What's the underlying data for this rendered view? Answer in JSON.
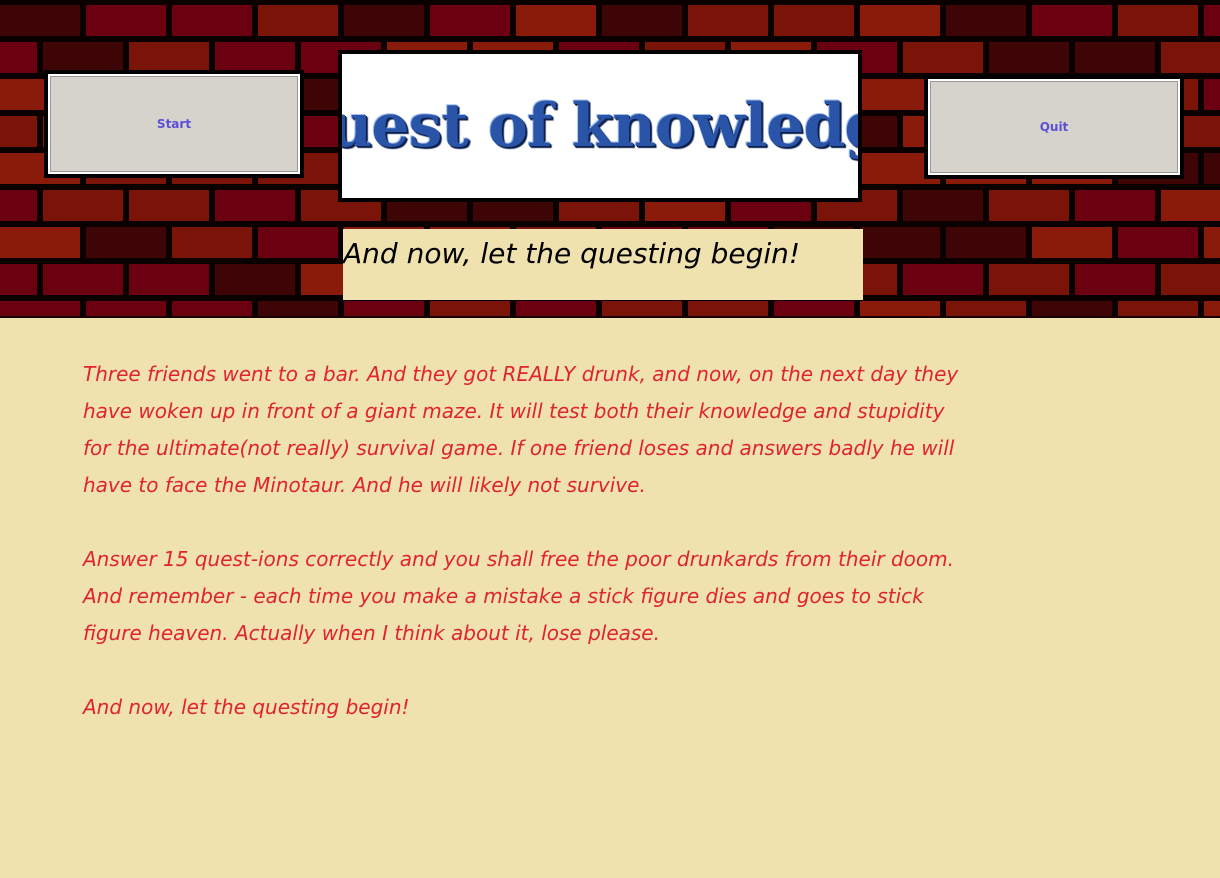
{
  "header": {
    "start_label": "Start",
    "quit_label": "Quit",
    "title": "Quest of knowledge",
    "subtitle": "And now, let the questing begin!"
  },
  "story": {
    "paragraph1": "Three friends went to a bar. And they got REALLY drunk, and now, on the next day they have woken up in front of a giant maze. It will test both their knowledge and stupidity for the ultimate(not really) survival game. If one friend loses and answers badly he will have to face the Minotaur. And he will likely not survive.",
    "paragraph2": "Answer 15 quest-ions correctly and you shall free the poor drunkards from their doom. And remember - each time you make a mistake a stick figure dies and goes to stick figure heaven. Actually when I think about it, lose please.",
    "paragraph3": "And now, let the questing begin!"
  },
  "colors": {
    "background": "#efe2ae",
    "story_text": "#e0242f",
    "button_text": "#5b4fd6",
    "title_text": "#2a54a8",
    "brick_colors": [
      "#6b0010",
      "#7a1308",
      "#3d0505",
      "#8a1a0a"
    ]
  }
}
